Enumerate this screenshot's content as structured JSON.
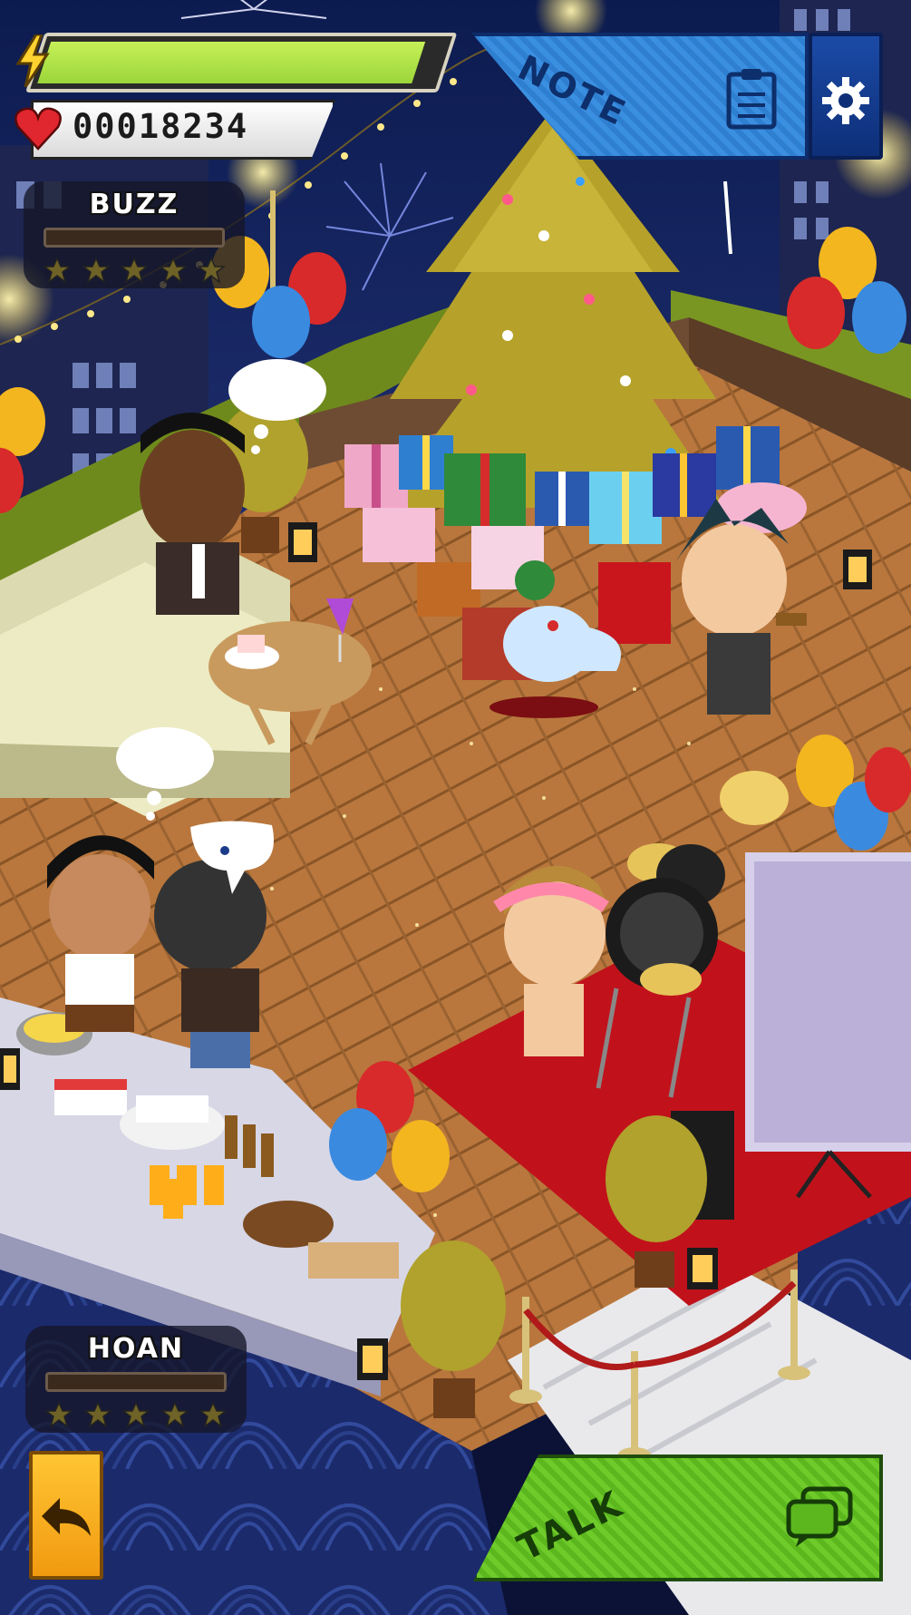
{
  "hud": {
    "energy": {
      "level": 0.95,
      "icon": "lightning-icon",
      "color": "#9bd63a"
    },
    "hearts": {
      "value": "00018234",
      "icon": "heart-icon"
    },
    "note": {
      "label": "NOTE",
      "icon": "clipboard-icon"
    },
    "settings": {
      "icon": "gear-icon"
    },
    "back": {
      "icon": "back-arrow-icon"
    },
    "talk": {
      "label": "TALK",
      "icon": "chat-bubbles-icon"
    }
  },
  "characters": [
    {
      "name": "BUZZ",
      "stars_filled": 0,
      "stars_total": 5,
      "meter_level": 0
    },
    {
      "name": "HOAN",
      "stars_filled": 0,
      "stars_total": 5,
      "meter_level": 0
    }
  ],
  "scene": {
    "setting": "rooftop-party",
    "colors": {
      "floor": "#b6743a",
      "carpet": "#c1121b",
      "night_sky": "#16265e",
      "rug_pattern": "#1c2c6e"
    }
  }
}
